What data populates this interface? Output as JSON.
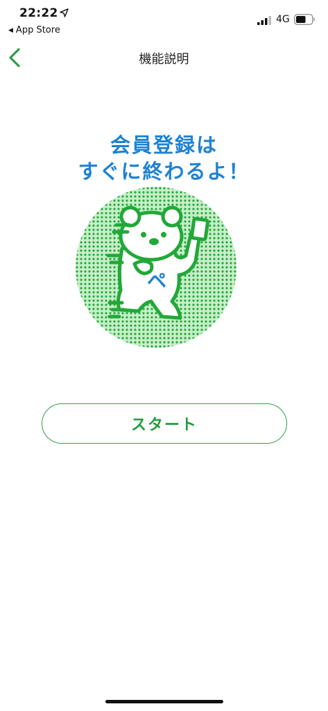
{
  "status_bar": {
    "time": "22:22",
    "back_app": "App Store",
    "network": "4G",
    "icons": [
      "location-arrow-icon",
      "cellular-signal-icon",
      "battery-icon"
    ]
  },
  "nav": {
    "title": "機能説明",
    "back_icon": "chevron-left-icon",
    "accent_color": "#2e9e45"
  },
  "main": {
    "headline_line1": "会員登録は",
    "headline_line2": "すぐに終わるよ！",
    "headline_color": "#1e82d2",
    "illustration": {
      "badge_text": "ペ",
      "icon": "bear-mascot-icon"
    },
    "start_button_label": "スタート"
  }
}
